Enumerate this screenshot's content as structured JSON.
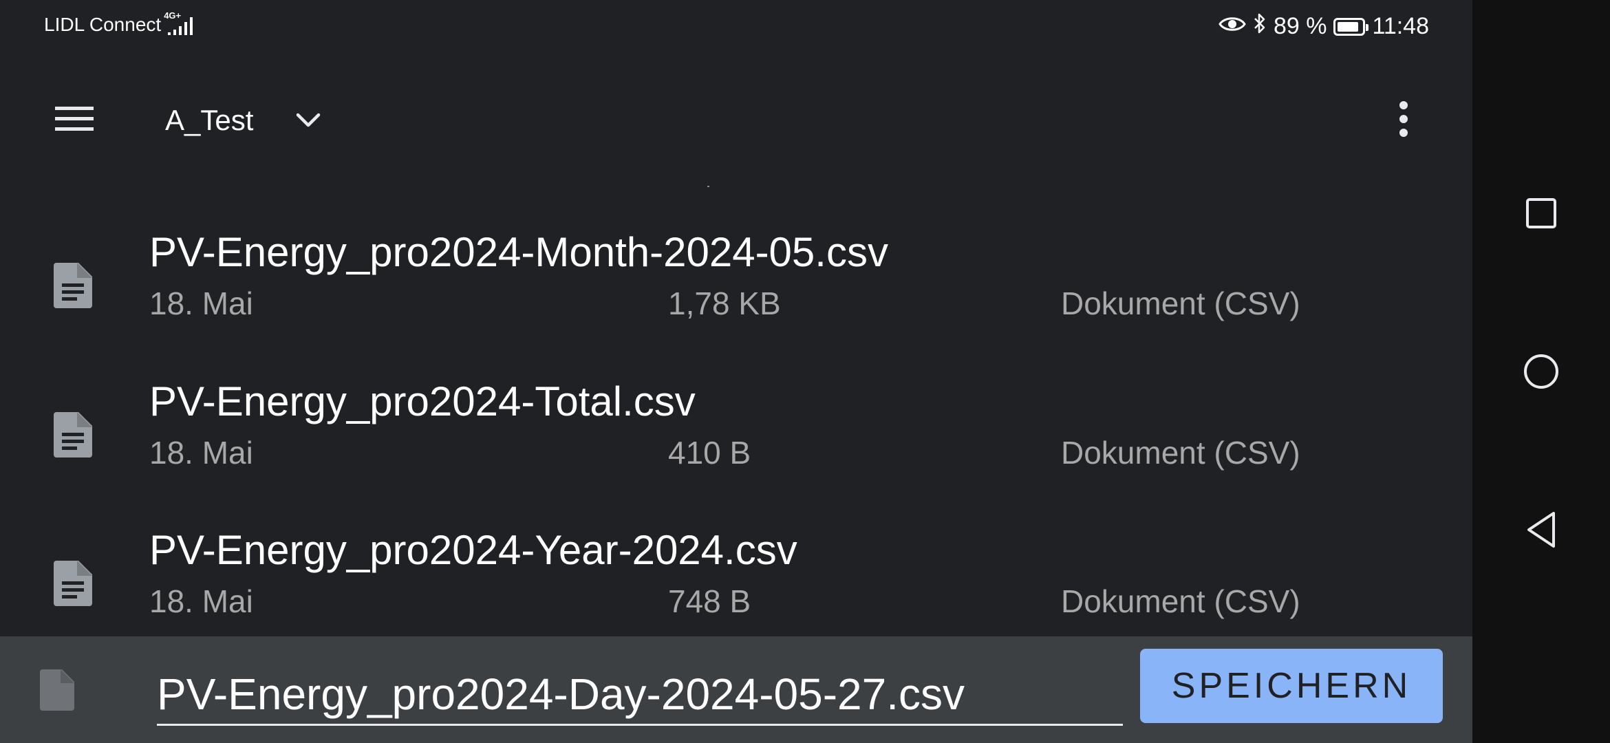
{
  "status_bar": {
    "carrier": "LIDL Connect",
    "network_type": "4G+",
    "battery_percent": "89 %",
    "battery_level": 0.89,
    "time": "11:48",
    "icons": [
      "eye-icon",
      "bluetooth-icon",
      "battery-icon",
      "signal-icon"
    ]
  },
  "app_bar": {
    "title": "A_Test",
    "icons": [
      "menu-icon",
      "chevron-down-icon",
      "more-vert-icon"
    ]
  },
  "files": [
    {
      "name": "PV-Energy_pro2024-Month-2024-05.csv",
      "date": "18. Mai",
      "size": "1,78 KB",
      "type": "Dokument (CSV)"
    },
    {
      "name": "PV-Energy_pro2024-Total.csv",
      "date": "18. Mai",
      "size": "410 B",
      "type": "Dokument (CSV)"
    },
    {
      "name": "PV-Energy_pro2024-Year-2024.csv",
      "date": "18. Mai",
      "size": "748 B",
      "type": "Dokument (CSV)"
    }
  ],
  "save_bar": {
    "filename_value": "PV-Energy_pro2024-Day-2024-05-27.csv",
    "save_label": "SPEICHERN"
  },
  "navigation_bar": {
    "icons": [
      "recents-square-icon",
      "home-circle-icon",
      "back-triangle-icon"
    ]
  },
  "colors": {
    "background": "#202124",
    "save_bar_background": "#3c4043",
    "accent_button": "#8ab4f8",
    "secondary_text": "#a8a8a8",
    "nav_bar": "#111111"
  }
}
